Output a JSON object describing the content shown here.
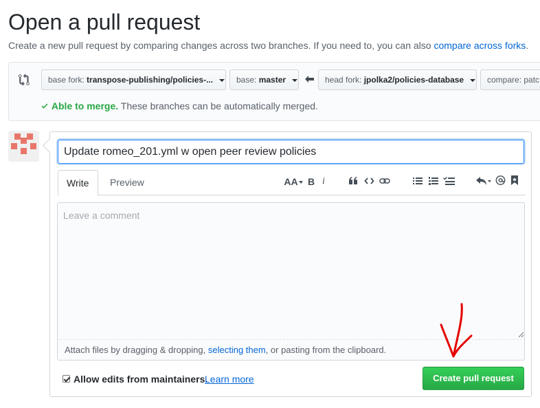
{
  "page": {
    "title": "Open a pull request",
    "description": "Create a new pull request by comparing changes across two branches. If you need to, you can also ",
    "description_link": "compare across forks",
    "description_end": "."
  },
  "range": {
    "base_fork_label": "base fork:",
    "base_fork_value": "transpose-publishing/policies-...",
    "base_label": "base:",
    "base_value": "master",
    "head_fork_label": "head fork:",
    "head_fork_value": "jpolka2/policies-database",
    "compare_label": "compare: patc",
    "merge_ok": "Able to merge.",
    "merge_text": " These branches can be automatically merged."
  },
  "composer": {
    "title_value": "Update romeo_201.yml w open peer review policies",
    "tab_write": "Write",
    "tab_preview": "Preview",
    "toolbar": {
      "heading": "AA",
      "bold": "B",
      "italic": "i"
    },
    "comment_placeholder": "Leave a comment",
    "drop_text_before": "Attach files by dragging & dropping, ",
    "drop_link": "selecting them",
    "drop_text_after": ", or pasting from the clipboard.",
    "allow_edits_label": "Allow edits from maintainers.",
    "learn_more": "Learn more",
    "create_button": "Create pull request"
  },
  "colors": {
    "accent_link": "#0366d6",
    "merge_green": "#28a745",
    "button_green": "#2ea44f",
    "annotation_red": "#e60000"
  }
}
